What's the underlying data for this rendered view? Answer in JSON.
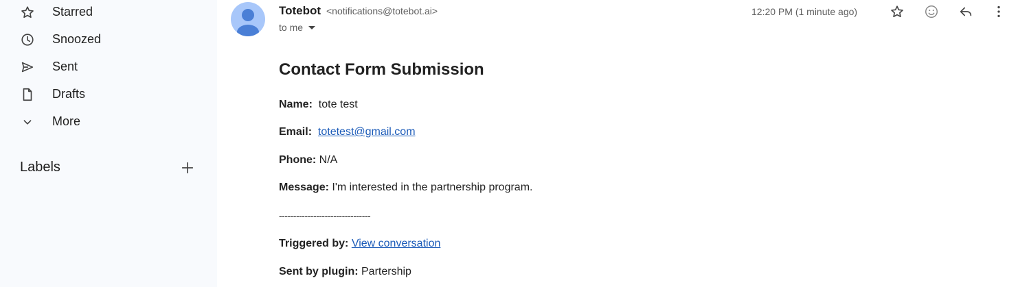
{
  "sidebar": {
    "items": [
      {
        "label": "Starred",
        "icon": "star-icon"
      },
      {
        "label": "Snoozed",
        "icon": "clock-icon"
      },
      {
        "label": "Sent",
        "icon": "send-icon"
      },
      {
        "label": "Drafts",
        "icon": "draft-icon"
      },
      {
        "label": "More",
        "icon": "chevron-down-icon"
      }
    ],
    "labels_title": "Labels"
  },
  "email": {
    "sender_name": "Totebot",
    "sender_email": "<notifications@totebot.ai>",
    "recipient": "to me",
    "timestamp": "12:20 PM (1 minute ago)",
    "subject": "Contact Form Submission",
    "fields": {
      "name_label": "Name:",
      "name_value": "tote test",
      "email_label": "Email:",
      "email_value": "totetest@gmail.com",
      "phone_label": "Phone:",
      "phone_value": "N/A",
      "message_label": "Message:",
      "message_value": "I'm interested in the partnership program.",
      "divider": "--------------------------------",
      "triggered_label": "Triggered by:",
      "triggered_link": "View conversation",
      "plugin_label": "Sent by plugin:",
      "plugin_value": "Partership"
    }
  },
  "colors": {
    "sidebar_bg": "#f8fafd",
    "link": "#1a5ab8",
    "avatar_bg": "#a8c7fa",
    "avatar_fg": "#4a7fd6"
  }
}
